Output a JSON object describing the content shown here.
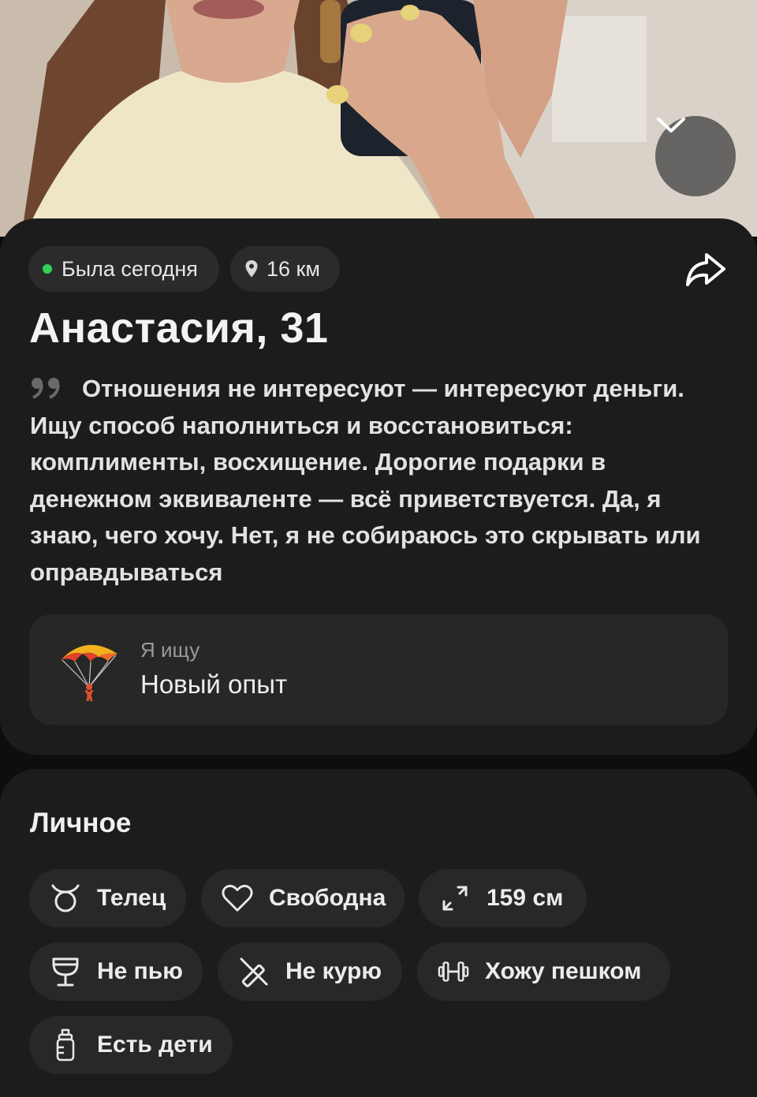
{
  "profile": {
    "status": "Была сегодня",
    "distance": "16 км",
    "name_age": "Анастасия, 31",
    "bio": "Отношения не интересуют — интересуют деньги. Ищу способ наполниться и восстановиться: комплименты, восхищение. Дорогие подарки в денежном эквиваленте — всё приветствуется. Да, я знаю, чего хочу. Нет, я не собираюсь это скрывать или оправдываться",
    "looking_for": {
      "label": "Я ищу",
      "value": "Новый опыт",
      "emoji": "parachute-icon"
    }
  },
  "personal": {
    "title": "Личное",
    "chips": [
      {
        "icon": "taurus-icon",
        "label": "Телец"
      },
      {
        "icon": "heart-icon",
        "label": "Свободна"
      },
      {
        "icon": "height-arrows-icon",
        "label": "159 см"
      },
      {
        "icon": "glass-icon",
        "label": "Не пью"
      },
      {
        "icon": "no-smoking-icon",
        "label": "Не курю"
      },
      {
        "icon": "dumbbell-icon",
        "label": "Хожу пешком"
      },
      {
        "icon": "baby-bottle-icon",
        "label": "Есть дети"
      }
    ]
  },
  "colors": {
    "online_dot": "#2fd15a",
    "card_bg": "#1c1c1c",
    "chip_bg": "#282828"
  }
}
